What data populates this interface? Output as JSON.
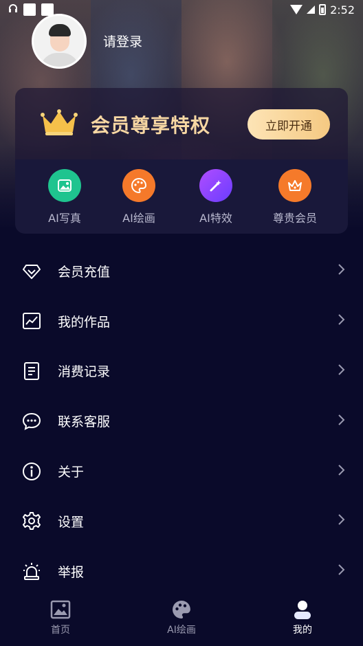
{
  "status_bar": {
    "time": "2:52",
    "icons": [
      "headphones-icon",
      "notification-square-icon",
      "notification-square-icon",
      "wifi-icon",
      "signal-icon",
      "battery-icon"
    ]
  },
  "profile": {
    "login_text": "请登录",
    "avatar_icon": "default-avatar"
  },
  "vip": {
    "title": "会员尊享特权",
    "button_label": "立即开通",
    "accent_color": "#f7d7a3",
    "features": [
      {
        "label": "AI写真",
        "icon": "photo-icon",
        "color": "#1fc48f"
      },
      {
        "label": "AI绘画",
        "icon": "palette-icon",
        "color": "#f5792a"
      },
      {
        "label": "AI特效",
        "icon": "magic-wand-icon",
        "color": "#8b4dff"
      },
      {
        "label": "尊贵会员",
        "icon": "crown-icon",
        "color": "#f57a2a"
      }
    ]
  },
  "menu": [
    {
      "label": "会员充值",
      "icon": "diamond-icon"
    },
    {
      "label": "我的作品",
      "icon": "chart-icon"
    },
    {
      "label": "消费记录",
      "icon": "document-icon"
    },
    {
      "label": "联系客服",
      "icon": "chat-bubble-icon"
    },
    {
      "label": "关于",
      "icon": "info-icon"
    },
    {
      "label": "设置",
      "icon": "gear-icon"
    },
    {
      "label": "举报",
      "icon": "alarm-icon"
    }
  ],
  "bottom_nav": [
    {
      "label": "首页",
      "icon": "image-icon",
      "active": false
    },
    {
      "label": "AI绘画",
      "icon": "palette-icon",
      "active": false
    },
    {
      "label": "我的",
      "icon": "user-icon",
      "active": true
    }
  ]
}
